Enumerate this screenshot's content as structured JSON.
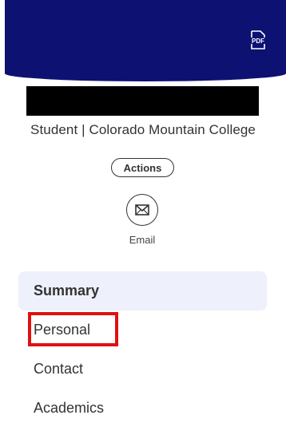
{
  "header": {
    "banner_color": "#0d1172",
    "pdf_icon": "pdf-icon",
    "pdf_text": "PDF"
  },
  "profile": {
    "subtitle": "Student | Colorado Mountain College",
    "actions_label": "Actions",
    "email_icon": "envelope-icon",
    "email_label": "Email"
  },
  "nav": {
    "items": [
      {
        "label": "Summary",
        "active": true
      },
      {
        "label": "Personal",
        "highlighted": true
      },
      {
        "label": "Contact"
      },
      {
        "label": "Academics"
      }
    ],
    "active_bg": "#eef0fb",
    "highlight_color": "#e01010"
  }
}
